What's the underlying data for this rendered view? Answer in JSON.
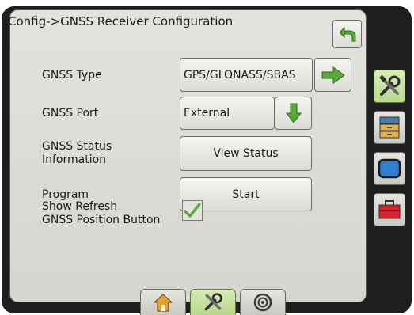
{
  "header": {
    "title": "Config->GNSS Receiver Configuration",
    "back_icon": "back-arrow-icon"
  },
  "rows": {
    "gnss_type": {
      "label": "GNSS Type",
      "value": "GPS/GLONASS/SBAS",
      "action_icon": "right-arrow-icon"
    },
    "gnss_port": {
      "label": "GNSS Port",
      "value": "External",
      "action_icon": "down-arrow-icon"
    },
    "gnss_status": {
      "label_line1": "GNSS Status",
      "label_line2": "Information",
      "button": "View Status"
    },
    "program": {
      "label": "Program",
      "button": "Start"
    },
    "show_refresh": {
      "label_line1": "Show Refresh",
      "label_line2": "GNSS Position Button",
      "checked": true
    }
  },
  "side_tabs": [
    {
      "icon": "tools-icon",
      "active": true
    },
    {
      "icon": "file-cabinet-icon",
      "active": false
    },
    {
      "icon": "display-icon",
      "active": false
    },
    {
      "icon": "toolbox-icon",
      "active": false
    }
  ],
  "bottom_tabs": [
    {
      "icon": "home-icon",
      "active": false
    },
    {
      "icon": "tools-icon",
      "active": true
    },
    {
      "icon": "target-icon",
      "active": false
    }
  ],
  "colors": {
    "accent_green": "#5aa838",
    "panel_bg": "#dcdcd7",
    "device_bezel": "#1e1e1e"
  }
}
